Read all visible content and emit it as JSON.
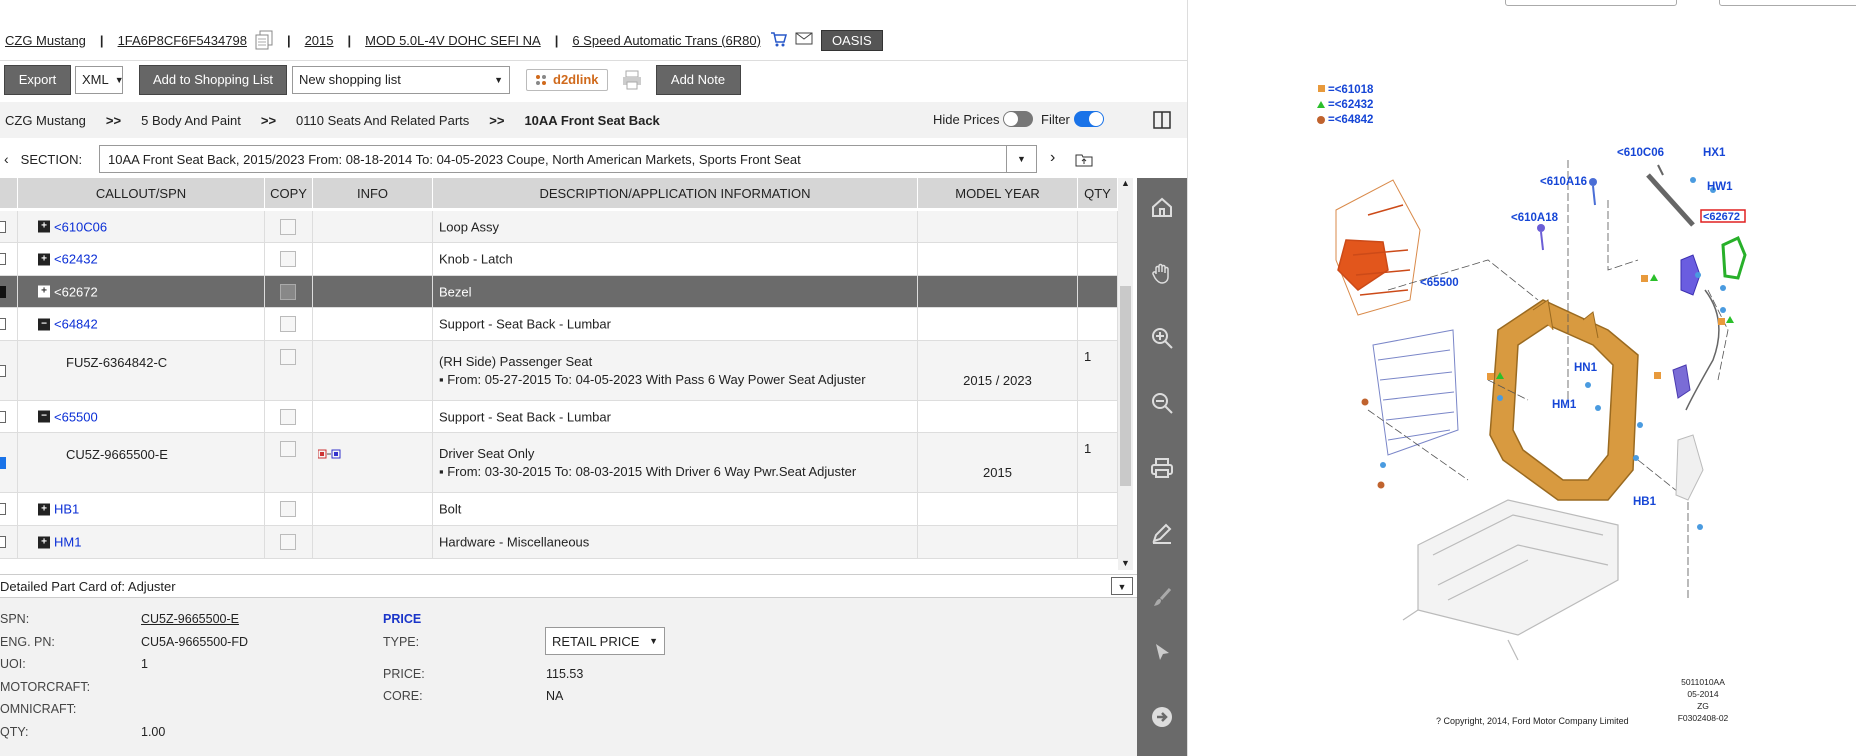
{
  "header": {
    "model": "CZG Mustang",
    "vin": "1FA6P8CF6F5434798",
    "year": "2015",
    "engine": "MOD 5.0L-4V DOHC SEFI NA",
    "trans": "6 Speed Automatic Trans (6R80)",
    "oasis": "OASIS",
    "sep": "|"
  },
  "toolbar": {
    "export": "Export",
    "format": "XML",
    "add_to_list": "Add to Shopping List",
    "list_select": "New shopping list",
    "d2d": "d2dlink",
    "add_note": "Add Note"
  },
  "breadcrumb": {
    "items": [
      "CZG Mustang",
      "5 Body And Paint",
      "0110 Seats And Related Parts",
      "10AA Front Seat Back"
    ],
    "sep": ">>",
    "hide_prices": "Hide Prices",
    "filter": "Filter"
  },
  "section": {
    "label": "SECTION:",
    "value": "10AA Front Seat Back, 2015/2023 From: 08-18-2014 To: 04-05-2023 Coupe, North American Markets, Sports Front Seat"
  },
  "table": {
    "headers": [
      "CALLOUT/SPN",
      "COPY",
      "INFO",
      "DESCRIPTION/APPLICATION INFORMATION",
      "MODEL YEAR",
      "QTY"
    ],
    "rows": [
      {
        "callout": "<610C06",
        "pm": "+",
        "desc": "Loop Assy"
      },
      {
        "callout": "<62432",
        "pm": "+",
        "desc": "Knob - Latch"
      },
      {
        "callout": "<62672",
        "pm": "+",
        "desc": "Bezel"
      },
      {
        "callout": "<64842",
        "pm": "−",
        "desc": "Support - Seat Back - Lumbar"
      },
      {
        "part": "FU5Z-6364842-C",
        "desc1": "(RH Side) Passenger Seat",
        "desc2": "▪ From: 05-27-2015 To: 04-05-2023 With Pass 6 Way Power Seat Adjuster",
        "year": "2015 / 2023",
        "qty": "1"
      },
      {
        "callout": "<65500",
        "pm": "−",
        "desc": "Support - Seat Back - Lumbar"
      },
      {
        "part": "CU5Z-9665500-E",
        "desc1": "Driver Seat Only",
        "desc2": "▪ From: 03-30-2015 To: 08-03-2015 With Driver 6 Way Pwr.Seat Adjuster",
        "year": "2015",
        "qty": "1"
      },
      {
        "callout": "HB1",
        "pm": "+",
        "desc": "Bolt"
      },
      {
        "callout": "HM1",
        "pm": "+",
        "desc": "Hardware - Miscellaneous"
      }
    ]
  },
  "detail": {
    "title": "Detailed Part Card of: Adjuster",
    "spn_label": "SPN:",
    "spn": "CU5Z-9665500-E",
    "eng_label": "ENG. PN:",
    "eng": "CU5A-9665500-FD",
    "uoi_label": "UOI:",
    "uoi": "1",
    "motorcraft_label": "MOTORCRAFT:",
    "omnicraft_label": "OMNICRAFT:",
    "qty_label": "QTY:",
    "qty": "1.00",
    "price_heading": "PRICE",
    "type_label": "TYPE:",
    "type": "RETAIL PRICE",
    "price_label": "PRICE:",
    "price": "115.53",
    "core_label": "CORE:",
    "core": "NA"
  },
  "diagram": {
    "legend": [
      "=<61018",
      "=<62432",
      "=<64842"
    ],
    "labels": [
      "<610C06",
      "HX1",
      "<610A16",
      "HW1",
      "<610A18",
      "<62672",
      "<65500",
      "HN1",
      "HM1",
      "HB1"
    ],
    "stamp": [
      "5011010AA",
      "05-2014",
      "ZG",
      "F0302408-02"
    ],
    "copyright": "? Copyright, 2014, Ford Motor Company Limited"
  }
}
